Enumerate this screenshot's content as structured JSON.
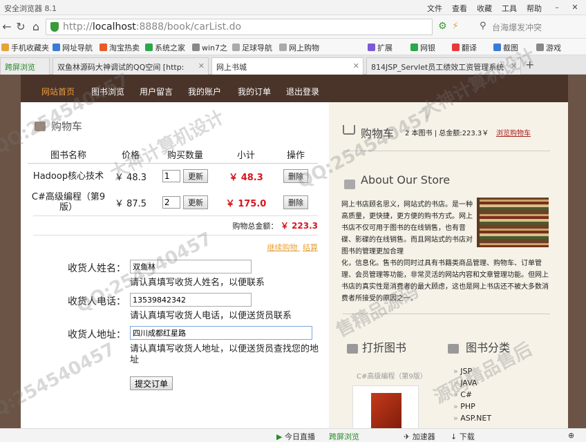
{
  "browser": {
    "title": "安全浏览器 8.1",
    "menu": [
      "文件",
      "查看",
      "收藏",
      "工具",
      "帮助"
    ],
    "url_prefix": "http://",
    "url_host": "localhost",
    "url_rest": ":8888/book/carList.do",
    "search_placeholder": "台海爆发冲突",
    "bookmarks": [
      "手机收藏夹",
      "网址导航",
      "淘宝热卖",
      "系统之家",
      "win7之",
      "足球导航",
      "网上购物"
    ],
    "toolbar_right": [
      "扩展",
      "网银",
      "翻译",
      "截图",
      "游戏"
    ],
    "tabs": [
      "跨屏浏览",
      "双鱼林源码大神调试的QQ空间 [http:",
      "网上书城",
      "814JSP_Servlet员工绩效工资管理系统"
    ],
    "status_items": [
      "今日直播",
      "跨屏浏览",
      "加速器",
      "下载"
    ]
  },
  "nav": [
    "网站首页",
    "图书浏览",
    "用户留言",
    "我的账户",
    "我的订单",
    "退出登录"
  ],
  "cart": {
    "title": "购物车",
    "headers": [
      "图书名称",
      "价格",
      "购买数量",
      "小计",
      "操作"
    ],
    "rows": [
      {
        "name": "Hadoop核心技术",
        "price": "￥ 48.3",
        "qty": "1",
        "update": "更新",
        "subtotal": "￥ 48.3",
        "delete": "删除"
      },
      {
        "name": "C#高级编程（第9版）",
        "price": "￥ 87.5",
        "qty": "2",
        "update": "更新",
        "subtotal": "￥ 175.0",
        "delete": "删除"
      }
    ],
    "total_label": "购物总金额：",
    "total_value": "￥ 223.3",
    "continue_link": "继续购物",
    "checkout_link": "结算"
  },
  "form": {
    "name_label": "收货人姓名：",
    "name_value": "双鱼林",
    "name_hint": "请认真填写收货人姓名，以便联系",
    "phone_label": "收货人电话：",
    "phone_value": "13539842342",
    "phone_hint": "请认真填写收货人电话，以便送货员联系",
    "addr_label": "收货人地址：",
    "addr_value": "四川成都红星路",
    "addr_hint": "请认真填写收货人地址，以便送货员查找您的地址",
    "submit": "提交订单"
  },
  "sidebar": {
    "cart_title": "购物车",
    "cart_summary": "2 本图书 | 总金额:223.3￥",
    "cart_link": "浏览购物车",
    "about_title": "About Our Store",
    "about_p1": "网上书店顾名思义，网站式的书店。是一种高质量，更快捷，更方便的购书方式。网上书店不仅可用于图书的在线销售，也有音碟、影碟的在线销售。而且网站式的书店对图书的管理更加合理",
    "about_p2": "化，信息化。售书的同时过具有书籍类商品管理、购物车、订单管理、会员管理等功能，非常灵活的网站内容和文章管理功能。但网上书店的真实性是消费者的最大顾虑，这也是网上书店还不被大多数消费者所接受的原因之一。",
    "discount_title": "打折图书",
    "discount_book": "C#高级编程（第9版）",
    "category_title": "图书分类",
    "categories": [
      "JSP",
      "JAVA",
      "C#",
      "PHP",
      "ASP.NET"
    ]
  },
  "watermarks": [
    "QQ:254540457",
    "大神计算机设计",
    "源码精品售后",
    "QQ:254540457",
    "大神计算机设计",
    "QQ:254540457",
    "售精品源码",
    "QQ:254540457"
  ]
}
